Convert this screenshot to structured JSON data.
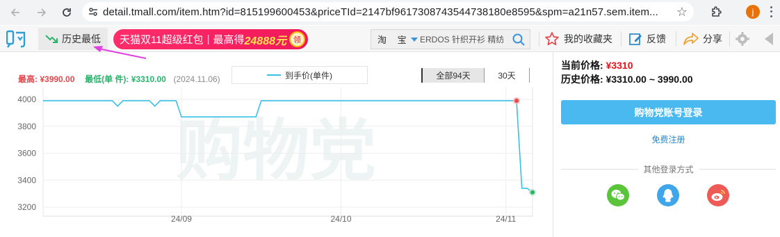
{
  "browser": {
    "url": "detail.tmall.com/item.htm?id=815199600453&priceTId=2147bf9617308743544738180e8595&spm=a21n57.sem.item....",
    "avatar_letter": "j",
    "accent_color": "#e8710a"
  },
  "toolbar": {
    "history_tab_label": "历史最低",
    "promo": {
      "part1": "天猫双11超级红包",
      "separator": "|",
      "part2": "最高得",
      "amount": "24888元",
      "badge": "领"
    },
    "search": {
      "platform": "淘  宝",
      "query": "ERDOS 针织开衫 精纺"
    },
    "favorites_label": "我的收藏夹",
    "feedback_label": "反馈",
    "share_label": "分享"
  },
  "chart_header": {
    "high_label": "最高:",
    "high_value": "¥3990.00",
    "low_label": "最低(单  件):",
    "low_value": "¥3310.00",
    "low_date": "(2024.11.06)",
    "legend_label": "到手价(单件)",
    "range_all": "全部94天",
    "range_30": "30天"
  },
  "chart_data": {
    "type": "line",
    "watermark": "购物党",
    "series": [
      {
        "name": "到手价(单件)",
        "color": "#38c0e8",
        "points": [
          [
            "2024-08-06",
            3990
          ],
          [
            "2024-08-19",
            3990
          ],
          [
            "2024-08-20",
            3950
          ],
          [
            "2024-08-21",
            3990
          ],
          [
            "2024-08-26",
            3990
          ],
          [
            "2024-08-27",
            3950
          ],
          [
            "2024-08-28",
            3990
          ],
          [
            "2024-08-31",
            3990
          ],
          [
            "2024-09-01",
            3870
          ],
          [
            "2024-09-15",
            3870
          ],
          [
            "2024-09-16",
            3990
          ],
          [
            "2024-11-03",
            3990
          ],
          [
            "2024-11-04",
            3340
          ],
          [
            "2024-11-05",
            3340
          ],
          [
            "2024-11-06",
            3310
          ]
        ]
      }
    ],
    "x_ticks": [
      "24/09",
      "24/10",
      "24/11"
    ],
    "y_ticks": [
      3200,
      3400,
      3600,
      3800,
      4000
    ],
    "ylim": [
      3200,
      4000
    ],
    "grid": true,
    "max_marker": {
      "date": "2024-11-03",
      "value": 3990,
      "color": "#e2474b"
    },
    "min_marker": {
      "date": "2024-11-06",
      "value": 3310,
      "color": "#29b36b"
    }
  },
  "right_panel": {
    "current_label": "当前价格:",
    "current_value": "¥3310",
    "history_label": "历史价格:",
    "history_value": "¥3310.00 ~ 3990.00",
    "login_button": "购物党账号登录",
    "register_link": "免费注册",
    "other_login_title": "其他登录方式",
    "social": [
      {
        "icon": "wechat-icon",
        "color": "#5ac53a"
      },
      {
        "icon": "qq-icon",
        "color": "#3fa6ea"
      },
      {
        "icon": "weibo-icon",
        "color": "#ee5a55"
      }
    ]
  }
}
